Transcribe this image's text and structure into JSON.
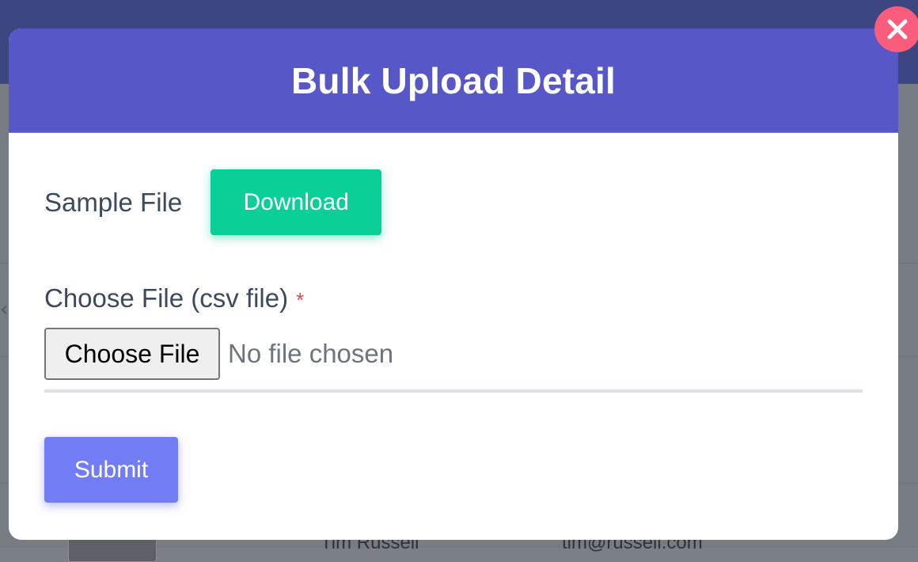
{
  "background": {
    "row_name": "Tim Russell",
    "row_email": "tim@russell.com",
    "chevron_icon": "chevron-left-icon"
  },
  "modal": {
    "title": "Bulk Upload Detail",
    "header_color": "#5757c7",
    "sample_file": {
      "label": "Sample File",
      "download_label": "Download",
      "download_color": "#0acf97"
    },
    "file_field": {
      "label": "Choose File (csv file)",
      "required_mark": "*",
      "button_label": "Choose File",
      "status_text": "No file chosen"
    },
    "submit_label": "Submit",
    "submit_color": "#727cf5",
    "close_icon": "close-icon",
    "close_color": "#fa5c7c"
  }
}
